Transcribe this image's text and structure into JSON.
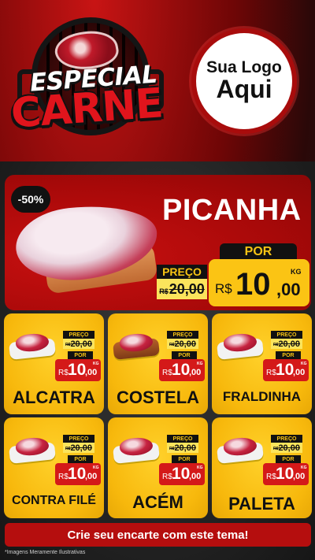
{
  "header": {
    "title_line1": "ESPECIAL",
    "title_line2": "CARNE",
    "logo_line1": "Sua Logo",
    "logo_line2": "Aqui"
  },
  "hero": {
    "badge": "-50%",
    "name": "PICANHA",
    "old_label": "PREÇO",
    "old_currency": "R$",
    "old_value": "20,00",
    "new_label": "POR",
    "currency": "R$",
    "price_int": "10",
    "price_dec": ",00",
    "unit": "KG"
  },
  "products": [
    {
      "name": "ALCATRA",
      "old_label": "PREÇO",
      "old_currency": "R$",
      "old_value": "20,00",
      "new_label": "POR",
      "currency": "R$",
      "price_int": "10",
      "price_dec": ",00",
      "unit": "KG"
    },
    {
      "name": "COSTELA",
      "old_label": "PREÇO",
      "old_currency": "R$",
      "old_value": "20,00",
      "new_label": "POR",
      "currency": "R$",
      "price_int": "10",
      "price_dec": ",00",
      "unit": "KG"
    },
    {
      "name": "FRALDINHA",
      "old_label": "PREÇO",
      "old_currency": "R$",
      "old_value": "20,00",
      "new_label": "POR",
      "currency": "R$",
      "price_int": "10",
      "price_dec": ",00",
      "unit": "KG"
    },
    {
      "name": "CONTRA FILÉ",
      "old_label": "PREÇO",
      "old_currency": "R$",
      "old_value": "20,00",
      "new_label": "POR",
      "currency": "R$",
      "price_int": "10",
      "price_dec": ",00",
      "unit": "KG"
    },
    {
      "name": "ACÉM",
      "old_label": "PREÇO",
      "old_currency": "R$",
      "old_value": "20,00",
      "new_label": "POR",
      "currency": "R$",
      "price_int": "10",
      "price_dec": ",00",
      "unit": "KG"
    },
    {
      "name": "PALETA",
      "old_label": "PREÇO",
      "old_currency": "R$",
      "old_value": "20,00",
      "new_label": "POR",
      "currency": "R$",
      "price_int": "10",
      "price_dec": ",00",
      "unit": "KG"
    }
  ],
  "footer": {
    "cta": "Crie seu encarte com este tema!",
    "disclaimer": "*Imagens Meramente Ilustrativas"
  },
  "colors": {
    "red": "#d41919",
    "yellow": "#fbc414",
    "dark": "#111111"
  },
  "icons": [
    "grill-icon",
    "steak-icon"
  ]
}
